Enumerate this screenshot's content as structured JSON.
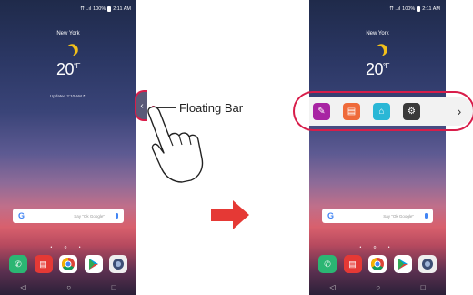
{
  "status": {
    "signal": "⇈ ..ıl",
    "battery": "100%",
    "time": "2:11 AM"
  },
  "weather": {
    "city": "New York",
    "temp": "20",
    "unit": "°F",
    "updated": "Updated 2:10 AM"
  },
  "search": {
    "logo": "G",
    "placeholder": "Say \"Ok Google\""
  },
  "page_dots": "• o •",
  "dock": [
    {
      "icon": "phone-icon",
      "color": "#2bb673"
    },
    {
      "icon": "messages-icon",
      "color": "#e53935"
    },
    {
      "icon": "chrome-icon",
      "color": "#ffffff"
    },
    {
      "icon": "play-store-icon",
      "color": "#ffffff"
    },
    {
      "icon": "camera-icon",
      "color": "#eeeeee"
    }
  ],
  "nav": {
    "back": "◁",
    "home": "○",
    "recent": "□"
  },
  "callout": {
    "label": "Floating Bar"
  },
  "floating_bar": {
    "items": [
      {
        "icon": "memo-icon",
        "color": "#a824a3"
      },
      {
        "icon": "notebook-icon",
        "color": "#ef6a3a"
      },
      {
        "icon": "capture-icon",
        "color": "#2ab7d6"
      },
      {
        "icon": "settings-icon",
        "color": "#3a3a3a"
      }
    ],
    "expand": "›",
    "collapse": "‹"
  },
  "accent": "#d81d4a"
}
